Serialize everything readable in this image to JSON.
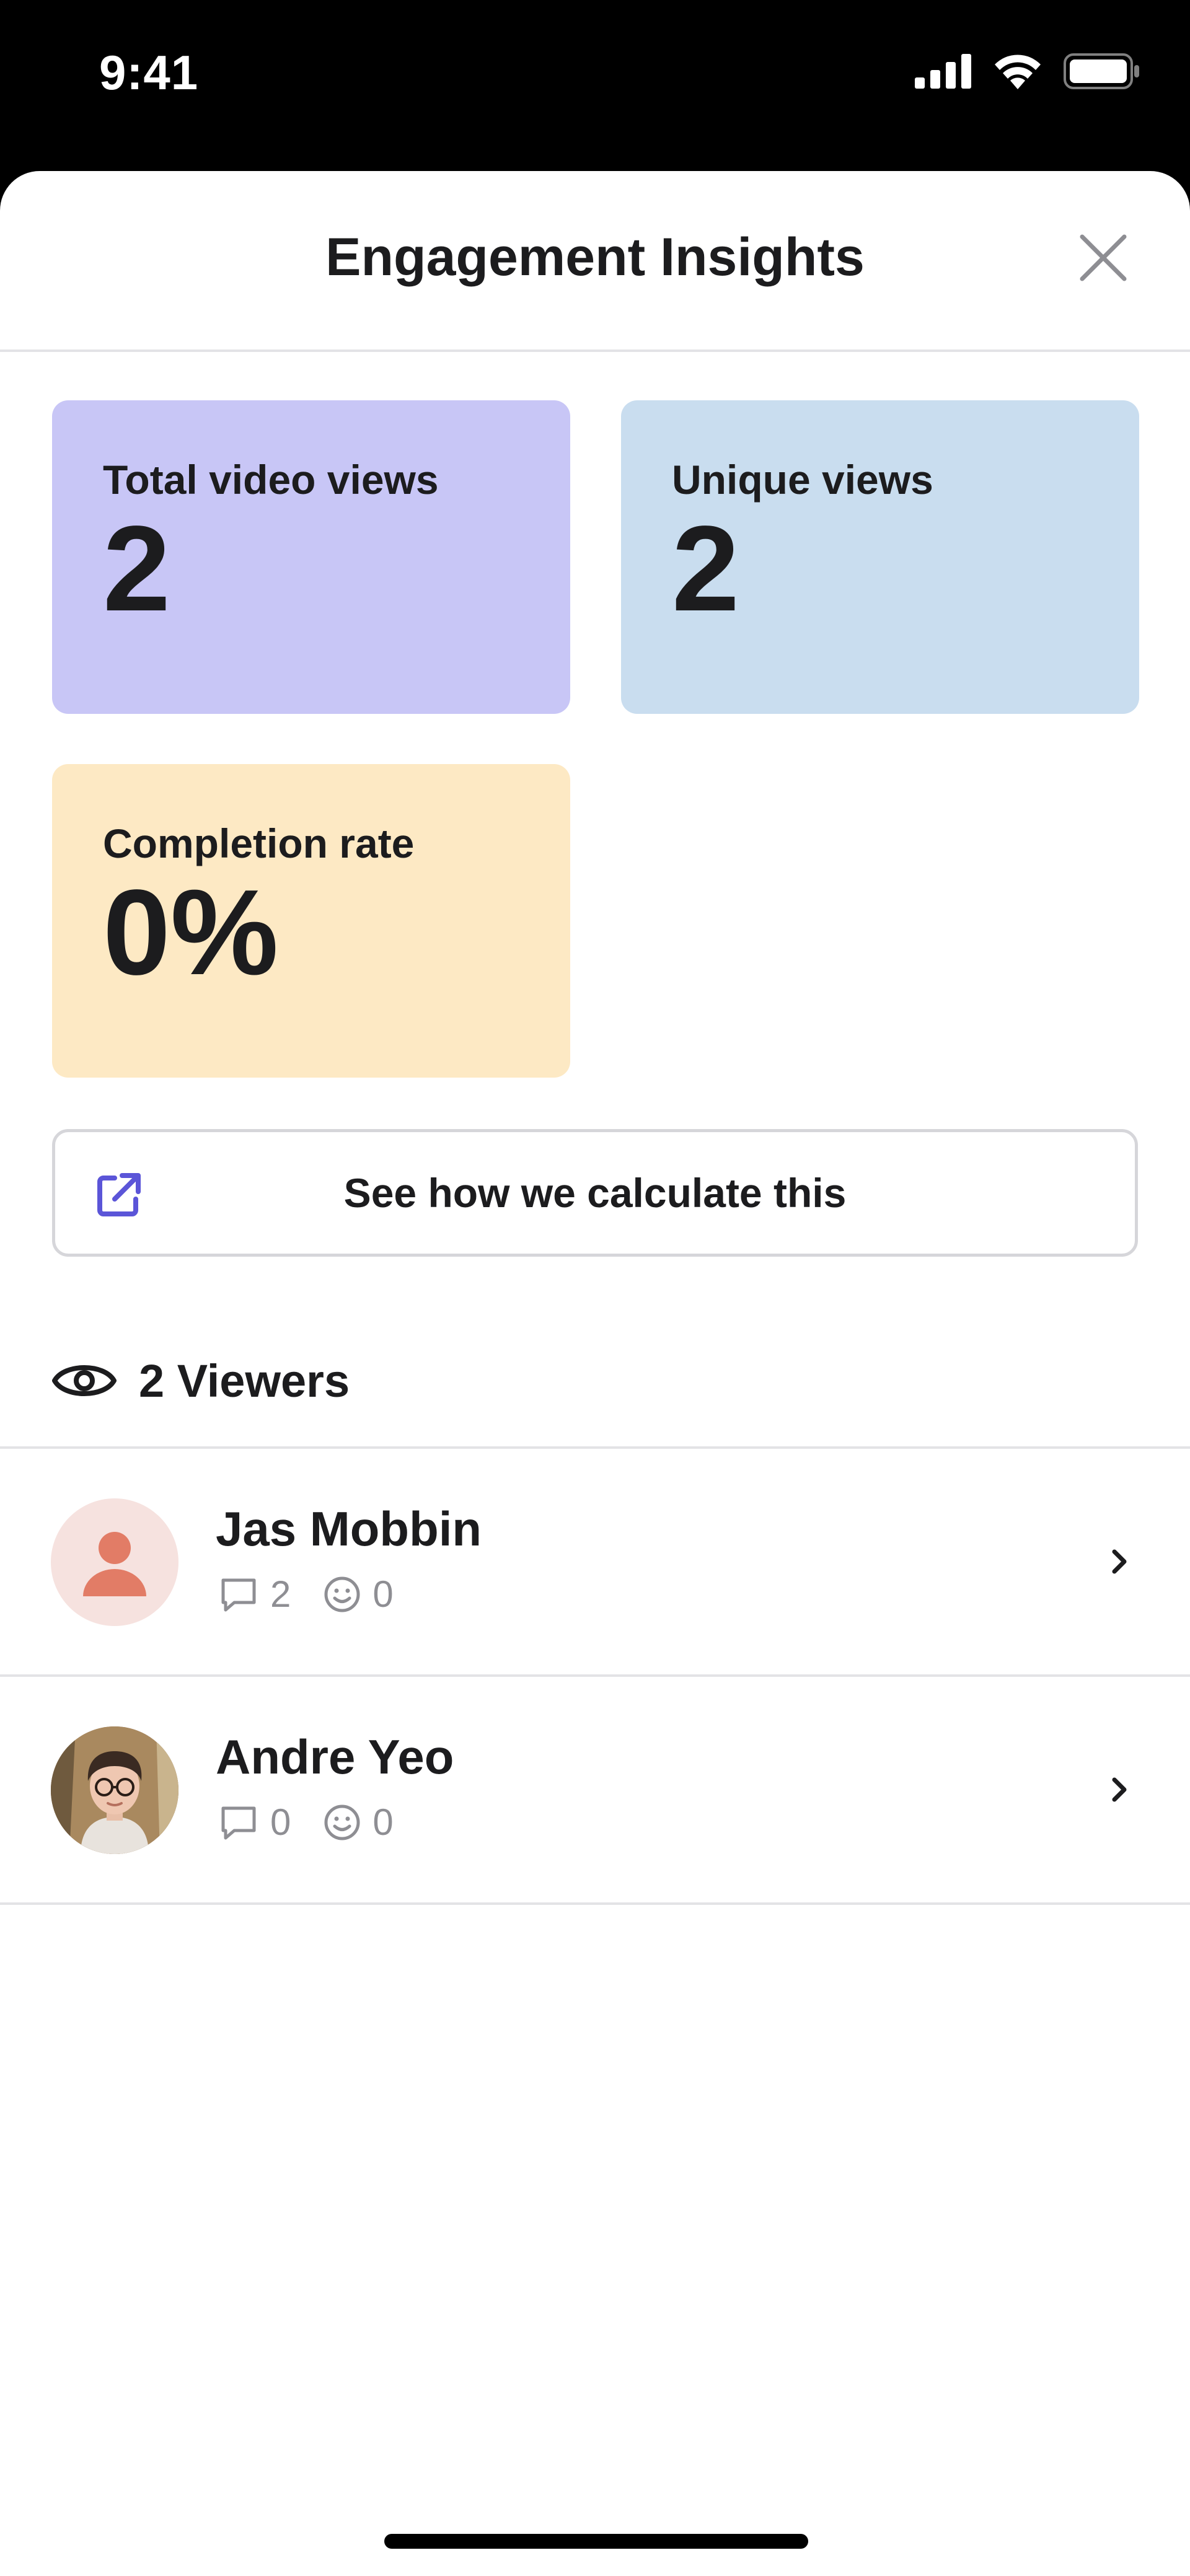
{
  "status_bar": {
    "time": "9:41",
    "icons": [
      "cellular-signal-icon",
      "wifi-icon",
      "battery-icon"
    ]
  },
  "sheet": {
    "title": "Engagement Insights",
    "close_icon": "close-icon"
  },
  "metrics": [
    {
      "label": "Total video views",
      "value": "2",
      "color": "#c8c6f6"
    },
    {
      "label": "Unique views",
      "value": "2",
      "color": "#c9ddef"
    },
    {
      "label": "Completion rate",
      "value": "0%",
      "color": "#fde9c4"
    }
  ],
  "calc_button": {
    "label": "See how we calculate this",
    "icon": "external-link-icon",
    "icon_color": "#5b55d8"
  },
  "viewers": {
    "heading": "2 Viewers",
    "icon": "eye-icon",
    "list": [
      {
        "name": "Jas Mobbin",
        "comments": "2",
        "reactions": "0",
        "avatar": "default-person-avatar"
      },
      {
        "name": "Andre Yeo",
        "comments": "0",
        "reactions": "0",
        "avatar": "photo-avatar"
      }
    ]
  }
}
